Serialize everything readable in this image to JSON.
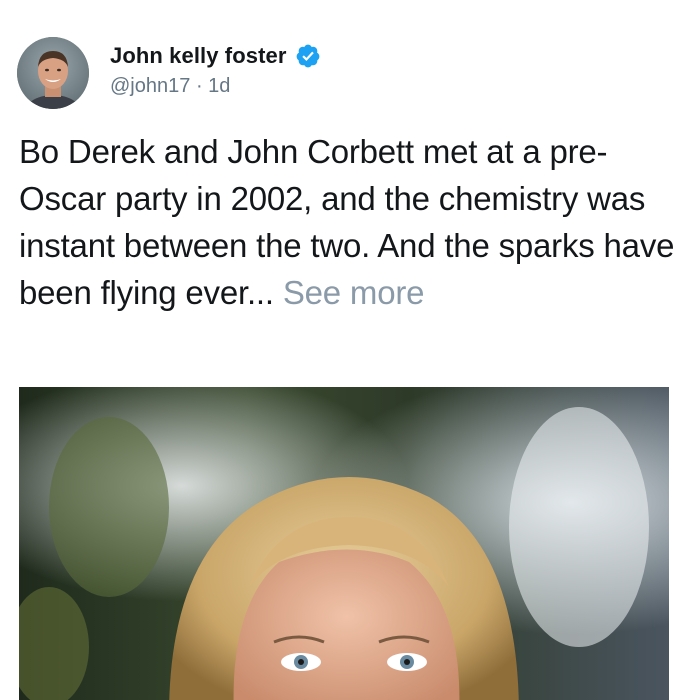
{
  "author": {
    "name": "John kelly foster",
    "handle": "@john17",
    "separator": "·",
    "time": "1d",
    "verified": true,
    "avatar_icon": "profile-photo"
  },
  "post": {
    "text": "Bo Derek and John Corbett met at a pre-Oscar party in 2002, and the chemistry was instant between the two. And the sparks have been flying ever...",
    "see_more": "See more"
  },
  "media": {
    "icon": "photo"
  },
  "colors": {
    "verified_blue": "#1da1f2",
    "text_primary": "#14171a",
    "text_secondary": "#657786",
    "see_more": "#8a9aa8"
  }
}
